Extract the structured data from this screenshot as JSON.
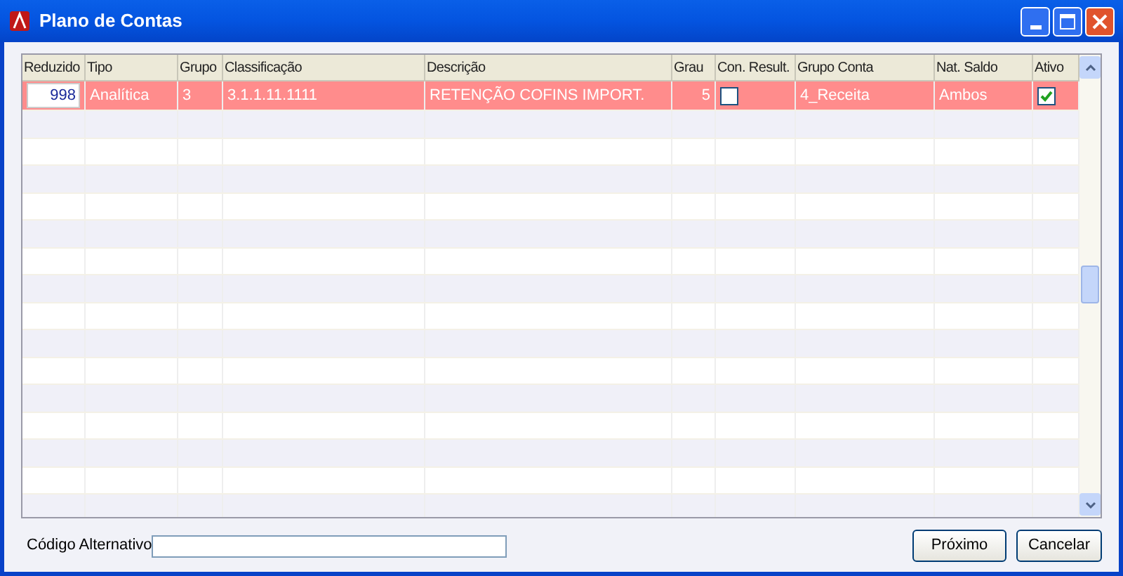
{
  "window": {
    "title": "Plano de Contas"
  },
  "table": {
    "columns": [
      "Reduzido",
      "Tipo",
      "Grupo",
      "Classificação",
      "Descrição",
      "Grau",
      "Con. Result.",
      "Grupo Conta",
      "Nat. Saldo",
      "Ativo"
    ],
    "rows": [
      {
        "selected": true,
        "reduzido": "998",
        "tipo": "Analítica",
        "grupo": "3",
        "classificacao": "3.1.1.11.1111",
        "descricao": "RETENÇÃO COFINS IMPORT.",
        "grau": "5",
        "con_result": {
          "checked": false
        },
        "grupo_conta": "4_Receita",
        "nat_saldo": "Ambos",
        "ativo": {
          "checked": true
        }
      }
    ]
  },
  "footer": {
    "label": "Código Alternativo",
    "buttons": [
      "Próximo",
      "Cancelar"
    ]
  }
}
